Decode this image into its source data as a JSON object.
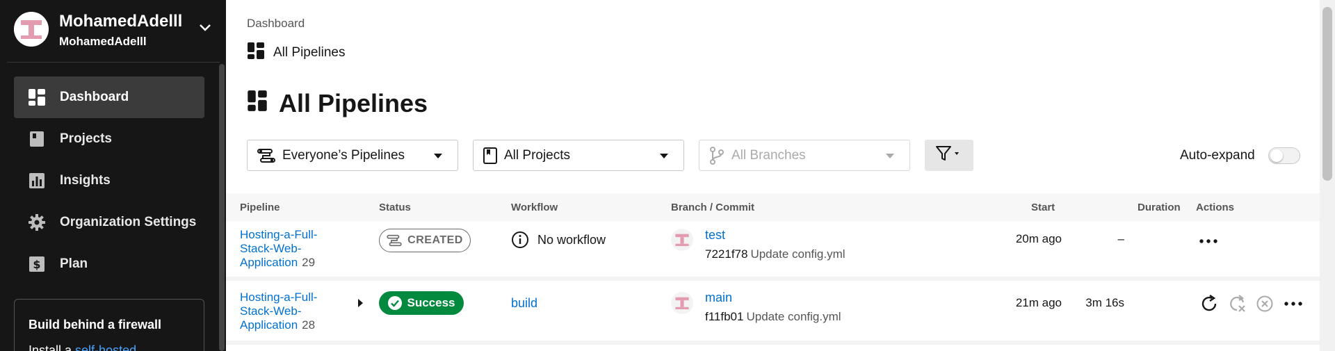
{
  "org": {
    "name": "MohamedAdelll",
    "subname": "MohamedAdelll"
  },
  "sidebar": {
    "items": [
      {
        "label": "Dashboard",
        "icon": "dashboard-icon",
        "active": true
      },
      {
        "label": "Projects",
        "icon": "projects-icon"
      },
      {
        "label": "Insights",
        "icon": "insights-icon"
      },
      {
        "label": "Organization Settings",
        "icon": "gear-icon"
      },
      {
        "label": "Plan",
        "icon": "dollar-icon"
      }
    ],
    "promo": {
      "title": "Build behind a firewall",
      "text_prefix": "Install a ",
      "link": "self-hosted"
    }
  },
  "breadcrumb": {
    "root": "Dashboard",
    "page": "All Pipelines"
  },
  "page_title": "All Pipelines",
  "filters": {
    "pipelines": "Everyone’s Pipelines",
    "projects": "All Projects",
    "branches": "All Branches"
  },
  "auto_expand": {
    "label": "Auto-expand",
    "enabled": false
  },
  "table": {
    "headers": {
      "pipeline": "Pipeline",
      "status": "Status",
      "workflow": "Workflow",
      "branch_commit": "Branch / Commit",
      "start": "Start",
      "duration": "Duration",
      "actions": "Actions"
    },
    "rows": [
      {
        "pipeline_line1": "Hosting-a-Full-",
        "pipeline_line2": "Stack-Web-",
        "pipeline_line3": "Application",
        "number": "29",
        "status": "CREATED",
        "workflow": "No workflow",
        "branch": "test",
        "commit_hash": "7221f78",
        "commit_msg": "Update config.yml",
        "start": "20m ago",
        "duration": "–"
      },
      {
        "pipeline_line1": "Hosting-a-Full-",
        "pipeline_line2": "Stack-Web-",
        "pipeline_line3": "Application",
        "number": "28",
        "status": "Success",
        "workflow": "build",
        "branch": "main",
        "commit_hash": "f11fb01",
        "commit_msg": "Update config.yml",
        "start": "21m ago",
        "duration": "3m 16s"
      }
    ]
  },
  "colors": {
    "sidebar_bg": "#161616",
    "link": "#0070d2",
    "success": "#048a3f",
    "avatar_pink": "#e8a0b4"
  }
}
